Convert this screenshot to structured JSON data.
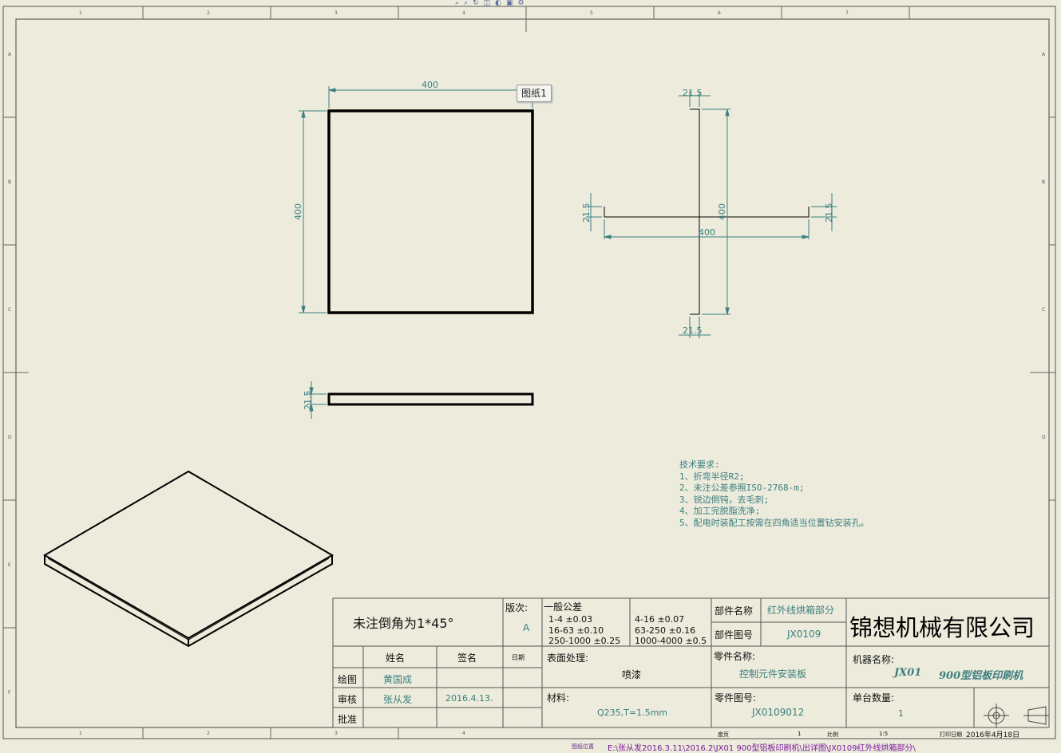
{
  "toolbar": {
    "icons": [
      "zoom-fit-icon",
      "zoom-area-icon",
      "rotate-icon",
      "view-orientation-icon",
      "display-style-icon",
      "hide-show-icon",
      "settings-icon"
    ]
  },
  "sheet_tab": {
    "label": "图纸1"
  },
  "border": {
    "cols_top": [
      "1",
      "2",
      "3",
      "4",
      "5",
      "6",
      "7"
    ],
    "cols_bottom": [
      "1",
      "2",
      "3",
      "4"
    ],
    "rows_left": [
      "A",
      "B",
      "C",
      "D",
      "E",
      "F"
    ],
    "rows_right": [
      "A",
      "B",
      "C",
      "D"
    ]
  },
  "front_view": {
    "width_dim": "400",
    "height_dim": "400"
  },
  "side_view": {
    "height_dim": "21.5"
  },
  "flat_pattern": {
    "flange_top": "21.5",
    "flange_bottom": "21.5",
    "flange_left": "21.5",
    "flange_right": "21.5",
    "width_dim": "400",
    "height_dim": "400"
  },
  "tech_req": {
    "title": "技术要求:",
    "items": [
      "1、折弯半径R2;",
      "2、未注公差参照ISO-2768-m;",
      "3、锐边倒钝，去毛刺;",
      "4、加工完脱脂洗净;",
      "5、配电时装配工按需在四角适当位置钻安装孔。"
    ]
  },
  "title_block": {
    "chamfer_note": "未注倒角为1*45°",
    "version_label": "版次:",
    "version_value": "A",
    "tolerance_title": "一般公差",
    "tolerances_left": [
      "1-4  ±0.03",
      "16-63  ±0.10",
      "250-1000  ±0.25"
    ],
    "tolerances_right": [
      "4-16  ±0.07",
      "63-250  ±0.16",
      "1000-4000  ±0.5"
    ],
    "part_name_label": "部件名称",
    "part_name_value": "红外线烘箱部分",
    "part_no_label": "部件图号",
    "part_no_value": "JX0109",
    "company": "锦想机械有限公司",
    "col_name": "姓名",
    "col_sign": "签名",
    "col_date": "日期",
    "row_draw": "绘图",
    "row_draw_name": "黄国成",
    "row_check": "审核",
    "row_check_name": "张从发",
    "row_check_date": "2016.4.13.",
    "row_approve": "批准",
    "surface_label": "表面处理:",
    "surface_value": "喷漆",
    "material_label": "材料:",
    "material_value": "Q235,T=1.5mm",
    "component_name_label": "零件名称:",
    "component_name_value": "控制元件安装板",
    "component_no_label": "零件图号:",
    "component_no_value": "JX0109012",
    "machine_label": "机器名称:",
    "machine_code": "JX01",
    "machine_value": "900型铝板印刷机",
    "qty_label": "单台数量:",
    "qty_value": "1",
    "footer_sheet_label": "度页",
    "footer_sheet_value": "1",
    "footer_scale_label": "比例",
    "footer_scale_value": "1:5",
    "footer_print_label": "打印日期",
    "footer_print_value": "2016年4月18日"
  },
  "path_bar": {
    "label": "图纸位置",
    "path": "E:\\张从发2016.3.11\\2016.2\\JX01  900型铝板印刷机\\出详图\\JX0109红外线烘箱部分\\"
  }
}
